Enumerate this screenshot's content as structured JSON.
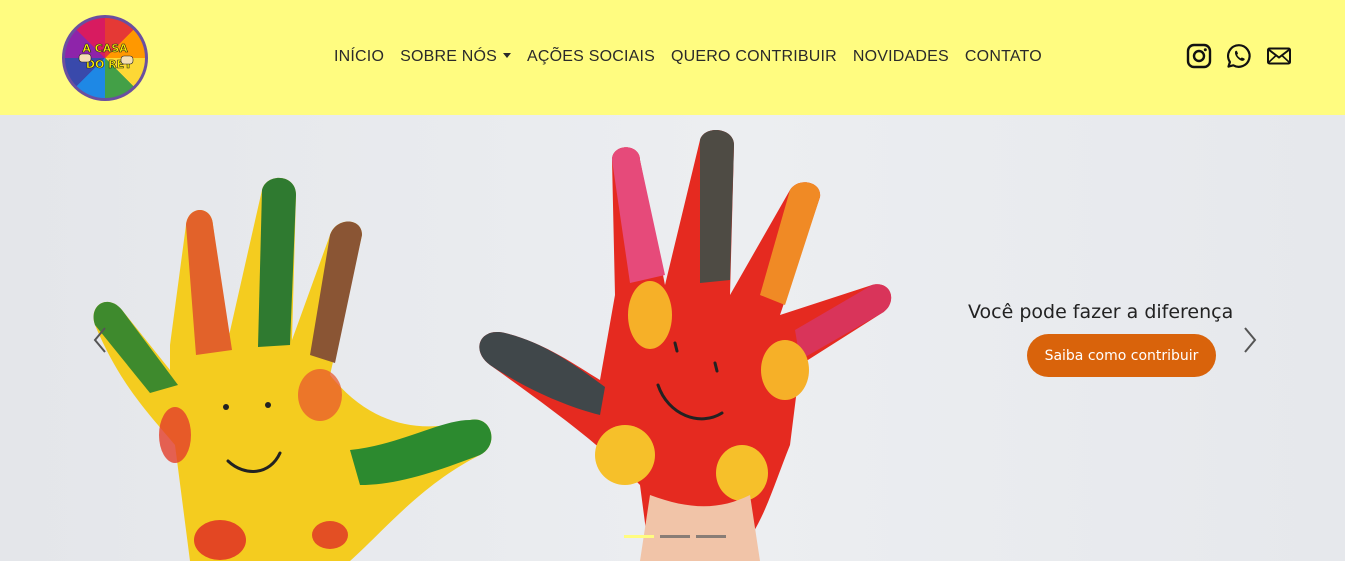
{
  "brand": {
    "logo_text_line1": "A CASA",
    "logo_text_line2": "DO REY"
  },
  "nav": {
    "items": [
      {
        "label": "INÍCIO"
      },
      {
        "label": "SOBRE NÓS"
      },
      {
        "label": "AÇÕES SOCIAIS"
      },
      {
        "label": "QUERO CONTRIBUIR"
      },
      {
        "label": "NOVIDADES"
      },
      {
        "label": "CONTATO"
      }
    ],
    "dropdown_item_index": 1
  },
  "social": {
    "icons": [
      "instagram-icon",
      "whatsapp-icon",
      "mail-icon"
    ]
  },
  "hero": {
    "caption_title": "Você pode fazer a diferença",
    "cta_label": "Saiba como contribuir",
    "slides_count": 3,
    "active_slide": 1
  },
  "colors": {
    "navbar_bg": "#fffc80",
    "cta_bg": "#d9630b",
    "indicator_active": "#fffc80"
  }
}
